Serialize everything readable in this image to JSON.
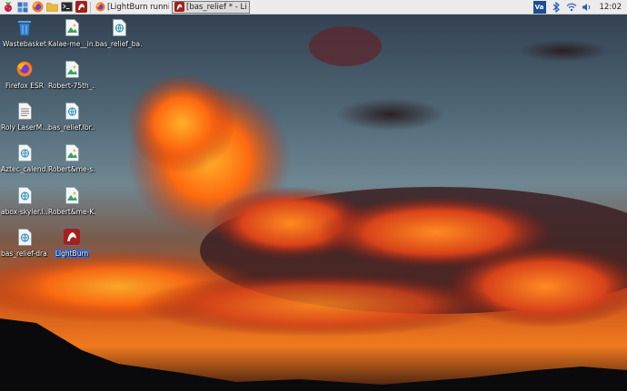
{
  "taskbar": {
    "launchers": [
      {
        "name": "raspberry-menu-icon"
      },
      {
        "name": "show-desktop-icon"
      },
      {
        "name": "firefox-icon"
      },
      {
        "name": "file-manager-icon"
      },
      {
        "name": "terminal-icon"
      },
      {
        "name": "lightburn-icon"
      }
    ],
    "windows": [
      {
        "label": "[LightBurn running o...",
        "icon": "firefox-icon"
      },
      {
        "label": "[bas_relief * - LightBu...",
        "icon": "lightburn-icon"
      }
    ],
    "tray": {
      "vnc_label": "Va",
      "clock": "12:02"
    }
  },
  "desktop": {
    "icons": [
      {
        "label": "Wastebasket",
        "icon": "wastebasket-icon"
      },
      {
        "label": "Kalae-me__in...",
        "icon": "image-file-icon"
      },
      {
        "label": "bas_relief_ba...",
        "icon": "lightburn-file-icon"
      },
      {
        "label": "Firefox ESR",
        "icon": "firefox-icon"
      },
      {
        "label": "Robert-75th_...",
        "icon": "image-file-icon"
      },
      {
        "label": "Roly LaserM...",
        "icon": "text-file-icon"
      },
      {
        "label": "bas_relief.lbr...",
        "icon": "lightburn-file-icon"
      },
      {
        "label": "Aztec_calend...",
        "icon": "lightburn-file-icon"
      },
      {
        "label": "Robert&me-s...",
        "icon": "image-file-icon"
      },
      {
        "label": "abox-skyler.l...",
        "icon": "lightburn-file-icon"
      },
      {
        "label": "Robert&me-K...",
        "icon": "image-file-icon"
      },
      {
        "label": "bas_relief-dra...",
        "icon": "lightburn-file-icon"
      },
      {
        "label": "LightBurn",
        "icon": "lightburn-app-icon",
        "selected": true
      }
    ]
  },
  "colors": {
    "taskbar_bg": "#ececec",
    "sky_top": "#2f3d4e",
    "cloud_fire": "#ff6a1a",
    "selection": "#3a6ed8",
    "mountain": "#0a0a0c"
  }
}
